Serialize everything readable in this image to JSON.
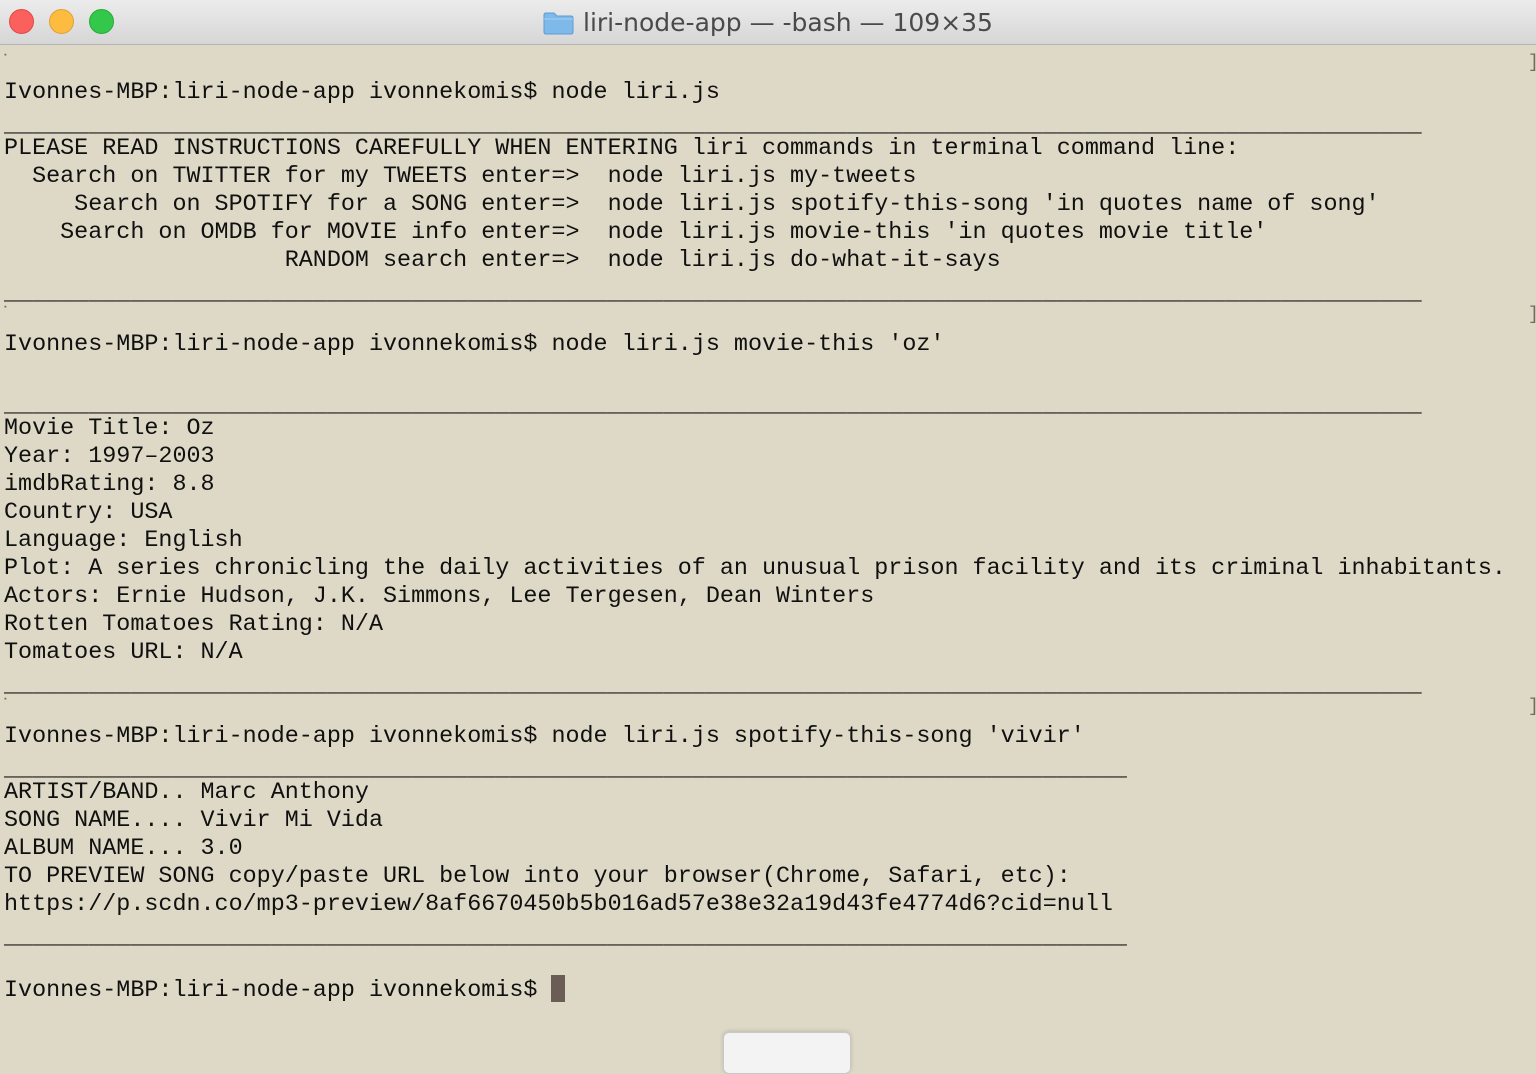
{
  "window": {
    "title": "liri-node-app — -bash — 109×35",
    "folder_icon": "folder-icon"
  },
  "terminal": {
    "lines": [
      {
        "prompt": "Ivonnes-MBP:liri-node-app ivonnekomis$ ",
        "command": "node liri.js"
      },
      {
        "text": "_____________________________________________________________________________________________________"
      },
      {
        "text": "PLEASE READ INSTRUCTIONS CAREFULLY WHEN ENTERING liri commands in terminal command line:"
      },
      {
        "text": "  Search on TWITTER for my TWEETS enter=>  node liri.js my-tweets"
      },
      {
        "text": "     Search on SPOTIFY for a SONG enter=>  node liri.js spotify-this-song 'in quotes name of song'"
      },
      {
        "text": "    Search on OMDB for MOVIE info enter=>  node liri.js movie-this 'in quotes movie title'"
      },
      {
        "text": "                    RANDOM search enter=>  node liri.js do-what-it-says"
      },
      {
        "text": "_____________________________________________________________________________________________________"
      },
      {
        "prompt": "Ivonnes-MBP:liri-node-app ivonnekomis$ ",
        "command": "node liri.js movie-this 'oz'"
      },
      {
        "text": "_____________________________________________________________________________________________________"
      },
      {
        "text": "Movie Title: Oz"
      },
      {
        "text": "Year: 1997–2003"
      },
      {
        "text": "imdbRating: 8.8"
      },
      {
        "text": "Country: USA"
      },
      {
        "text": "Language: English"
      },
      {
        "text": "Plot: A series chronicling the daily activities of an unusual prison facility and its criminal inhabitants."
      },
      {
        "text": "Actors: Ernie Hudson, J.K. Simmons, Lee Tergesen, Dean Winters"
      },
      {
        "text": "Rotten Tomatoes Rating: N/A"
      },
      {
        "text": "Tomatoes URL: N/A"
      },
      {
        "text": "_____________________________________________________________________________________________________"
      },
      {
        "prompt": "Ivonnes-MBP:liri-node-app ivonnekomis$ ",
        "command": "node liri.js spotify-this-song 'vivir'"
      },
      {
        "text": "________________________________________________________________________________"
      },
      {
        "text": "ARTIST/BAND.. Marc Anthony"
      },
      {
        "text": "SONG NAME.... Vivir Mi Vida"
      },
      {
        "text": "ALBUM NAME... 3.0"
      },
      {
        "text": "TO PREVIEW SONG copy/paste URL below into your browser(Chrome, Safari, etc):"
      },
      {
        "text": "https://p.scdn.co/mp3-preview/8af6670450b5b016ad57e38e32a19d43fe4774d6?cid=null"
      },
      {
        "text": "________________________________________________________________________________"
      },
      {
        "prompt": "Ivonnes-MBP:liri-node-app ivonnekomis$ ",
        "command": ""
      }
    ]
  },
  "colors": {
    "terminal_bg": "#ded9c6",
    "text": "#101010",
    "cursor": "#6a5d56"
  }
}
